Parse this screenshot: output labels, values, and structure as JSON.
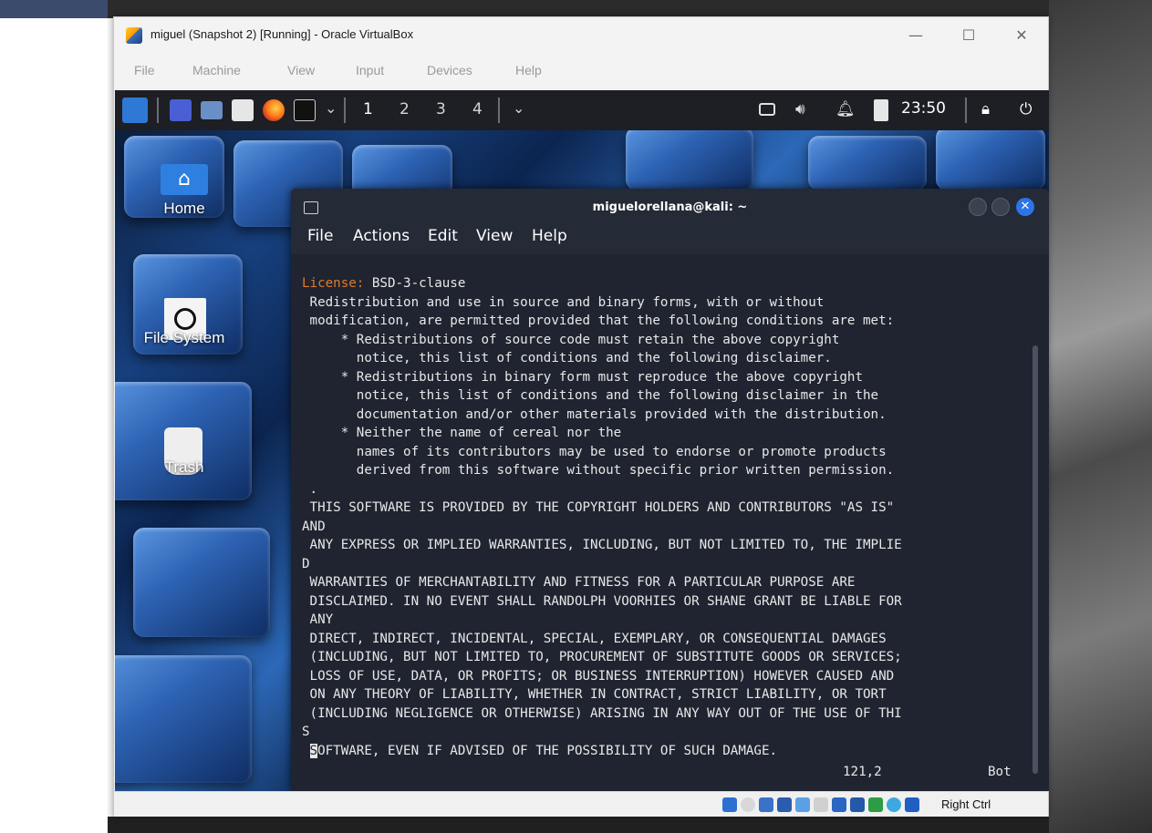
{
  "vbox": {
    "title": "miguel (Snapshot 2) [Running] - Oracle VirtualBox",
    "controls": {
      "minimize": "—",
      "maximize": "☐",
      "close": "✕"
    },
    "menu": [
      "File",
      "Machine",
      "View",
      "Input",
      "Devices",
      "Help"
    ],
    "status": {
      "host_key": "Right Ctrl"
    }
  },
  "panel": {
    "workspaces": [
      "1",
      "2",
      "3",
      "4"
    ],
    "clock": "23:50"
  },
  "desktop": {
    "icons": [
      {
        "label": "Home"
      },
      {
        "label": "File System"
      },
      {
        "label": "Trash"
      }
    ]
  },
  "terminal": {
    "title": "miguelorellana@kali: ~",
    "menu": [
      "File",
      "Actions",
      "Edit",
      "View",
      "Help"
    ],
    "license_key": "License:",
    "license_value": " BSD-3-clause",
    "lines": [
      " Redistribution and use in source and binary forms, with or without",
      " modification, are permitted provided that the following conditions are met:",
      "     * Redistributions of source code must retain the above copyright",
      "       notice, this list of conditions and the following disclaimer.",
      "     * Redistributions in binary form must reproduce the above copyright",
      "       notice, this list of conditions and the following disclaimer in the",
      "       documentation and/or other materials provided with the distribution.",
      "     * Neither the name of cereal nor the",
      "       names of its contributors may be used to endorse or promote products",
      "       derived from this software without specific prior written permission.",
      " .",
      " THIS SOFTWARE IS PROVIDED BY THE COPYRIGHT HOLDERS AND CONTRIBUTORS \"AS IS\"",
      "AND",
      " ANY EXPRESS OR IMPLIED WARRANTIES, INCLUDING, BUT NOT LIMITED TO, THE IMPLIE",
      "D",
      " WARRANTIES OF MERCHANTABILITY AND FITNESS FOR A PARTICULAR PURPOSE ARE",
      " DISCLAIMED. IN NO EVENT SHALL RANDOLPH VOORHIES OR SHANE GRANT BE LIABLE FOR",
      " ANY",
      " DIRECT, INDIRECT, INCIDENTAL, SPECIAL, EXEMPLARY, OR CONSEQUENTIAL DAMAGES",
      " (INCLUDING, BUT NOT LIMITED TO, PROCUREMENT OF SUBSTITUTE GOODS OR SERVICES;",
      " LOSS OF USE, DATA, OR PROFITS; OR BUSINESS INTERRUPTION) HOWEVER CAUSED AND",
      " ON ANY THEORY OF LIABILITY, WHETHER IN CONTRACT, STRICT LIABILITY, OR TORT",
      " (INCLUDING NEGLIGENCE OR OTHERWISE) ARISING IN ANY WAY OUT OF THE USE OF THI",
      "S"
    ],
    "last_line_prefix": " ",
    "last_line_cursor": "S",
    "last_line_rest": "OFTWARE, EVEN IF ADVISED OF THE POSSIBILITY OF SUCH DAMAGE.",
    "status_position": "121,2",
    "status_scroll": "Bot"
  },
  "colors": {
    "terminal_bg": "#1f2430",
    "license_key": "#e07a2a",
    "close_button": "#2c74e8"
  }
}
